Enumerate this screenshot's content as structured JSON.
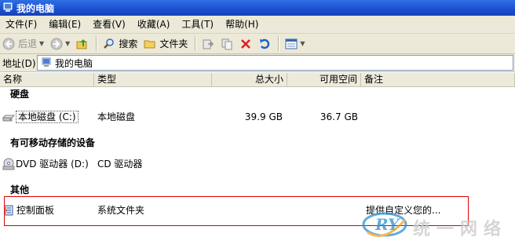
{
  "window": {
    "title": "我的电脑"
  },
  "menu": [
    "文件(F)",
    "编辑(E)",
    "查看(V)",
    "收藏(A)",
    "工具(T)",
    "帮助(H)"
  ],
  "toolbar": {
    "back": "后退",
    "search": "搜索",
    "folders": "文件夹"
  },
  "address": {
    "label": "地址(D)",
    "value": "我的电脑"
  },
  "columns": [
    "名称",
    "类型",
    "总大小",
    "可用空间",
    "备注"
  ],
  "groups": {
    "hard_disks": {
      "label": "硬盘",
      "items": [
        {
          "name": "本地磁盘 (C:)",
          "type": "本地磁盘",
          "total": "39.9 GB",
          "free": "36.7 GB",
          "note": ""
        }
      ]
    },
    "removable": {
      "label": "有可移动存储的设备",
      "items": [
        {
          "name": "DVD 驱动器 (D:)",
          "type": "CD 驱动器",
          "total": "",
          "free": "",
          "note": ""
        }
      ]
    },
    "other": {
      "label": "其他",
      "items": [
        {
          "name": "控制面板",
          "type": "系统文件夹",
          "total": "",
          "free": "",
          "note": "提供自定义您的..."
        }
      ]
    }
  },
  "watermark": {
    "text": "RY",
    "text2": "统一网络"
  },
  "colors": {
    "titlebar": "#1c4fcf",
    "chrome": "#ece9d8",
    "highlight_box": "#dd0000",
    "watermark": "#2a8fd6"
  }
}
